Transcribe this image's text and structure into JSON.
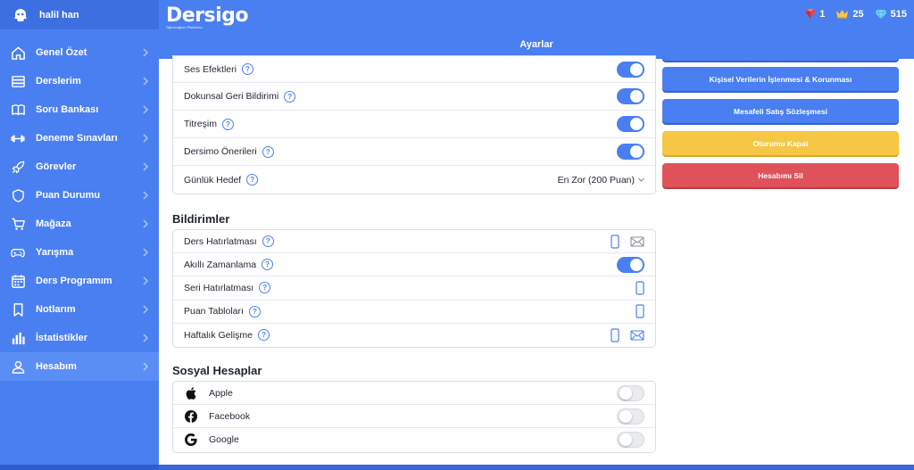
{
  "user": {
    "name": "halil han"
  },
  "sidebar": {
    "items": [
      {
        "label": "Genel Özet",
        "icon": "home-icon"
      },
      {
        "label": "Derslerim",
        "icon": "book-stack-icon"
      },
      {
        "label": "Soru Bankası",
        "icon": "open-book-icon"
      },
      {
        "label": "Deneme Sınavları",
        "icon": "dumbbell-icon"
      },
      {
        "label": "Görevler",
        "icon": "rocket-icon"
      },
      {
        "label": "Puan Durumu",
        "icon": "shield-icon"
      },
      {
        "label": "Mağaza",
        "icon": "cart-icon"
      },
      {
        "label": "Yarışma",
        "icon": "gamepad-icon"
      },
      {
        "label": "Ders Programım",
        "icon": "calendar-icon"
      },
      {
        "label": "Notlarım",
        "icon": "bookmark-icon"
      },
      {
        "label": "İstatistikler",
        "icon": "bar-chart-icon"
      },
      {
        "label": "Hesabım",
        "icon": "user-icon",
        "active": true
      }
    ]
  },
  "header": {
    "brand": "Dersigo",
    "tagline": "Öğrenciğinin Platformu",
    "title": "Ayarlar",
    "stats": {
      "ruby": "1",
      "crown": "25",
      "diamond": "515"
    }
  },
  "general": {
    "ses": "Ses Efektleri",
    "dokunsal": "Dokunsal Geri Bildirimi",
    "titresim": "Titreşim",
    "oneriler": "Dersimo Önerileri",
    "hedef": "Günlük Hedef",
    "hedef_value": "En Zor (200 Puan)"
  },
  "notifications": {
    "title": "Bildirimler",
    "ders": "Ders Hatırlatması",
    "akilli": "Akıllı Zamanlama",
    "seri": "Seri Hatırlatması",
    "puan": "Puan Tabloları",
    "haftalik": "Haftalık Gelişme"
  },
  "social": {
    "title": "Sosyal Hesaplar",
    "apple": "Apple",
    "facebook": "Facebook",
    "google": "Google"
  },
  "actions": {
    "kvkk": "Kişisel Verilerin İşlenmesi & Korunması",
    "mesafeli": "Mesafeli Satış Sözleşmesi",
    "logout": "Oturumu Kapat",
    "delete": "Hesabımı Sil"
  },
  "colors": {
    "primary": "#4a7ff2",
    "warning": "#f6c744",
    "danger": "#df525a"
  }
}
